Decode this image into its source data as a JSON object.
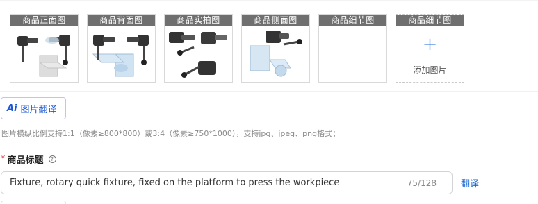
{
  "images": {
    "slots": [
      {
        "label": "商品正面图",
        "icon": "fixture-front-photo"
      },
      {
        "label": "商品背面图",
        "icon": "fixture-back-photo"
      },
      {
        "label": "商品实拍图",
        "icon": "fixture-real-photo"
      },
      {
        "label": "商品侧面图",
        "icon": "fixture-side-photo"
      },
      {
        "label": "商品细节图",
        "icon": ""
      },
      {
        "label": "商品细节图",
        "icon": "plus-icon"
      }
    ],
    "add_label": "添加图片"
  },
  "translate_image_button": {
    "ai": "Ai",
    "label": "图片翻译"
  },
  "hint": "图片横纵比例支持1:1（像素≥800*800）或3:4（像素≥750*1000），支持jpg、jpeg、png格式；",
  "title_field": {
    "required_mark": "*",
    "label": "商品标题",
    "help": "?",
    "value": "Fixture, rotary quick fixture, fixed on the platform to press the workpiece",
    "count": "75/128",
    "translate": "翻译"
  },
  "colors": {
    "accent": "#1a66d9",
    "label_bg": "#6f6f6f",
    "required": "#e6333a"
  }
}
